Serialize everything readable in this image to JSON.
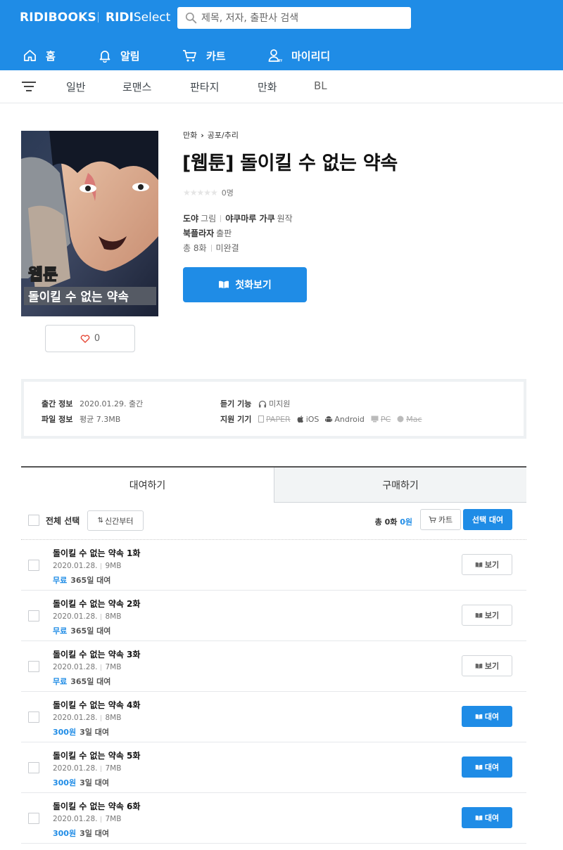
{
  "header": {
    "logo": "RIDIBOOKS",
    "select_brand": "RIDI",
    "select_suffix": "Select",
    "search_placeholder": "제목, 저자, 출판사 검색",
    "bg_color": "#1f8ce6",
    "nav": [
      {
        "label": "홈",
        "icon": "home-icon"
      },
      {
        "label": "알림",
        "icon": "bell-icon"
      },
      {
        "label": "카트",
        "icon": "cart-icon"
      },
      {
        "label": "마이리디",
        "icon": "my-icon"
      }
    ]
  },
  "categories": [
    "일반",
    "로맨스",
    "판타지",
    "만화",
    "BL"
  ],
  "book": {
    "breadcrumb": [
      "만화",
      "공포/추리"
    ],
    "title": "[웹툰] 돌이킬 수 없는 약속",
    "rating_count": "0명",
    "rating_stars": 0,
    "author": "도야",
    "author_role": "그림",
    "original_author": "야쿠마루 가쿠",
    "original_role": "원작",
    "publisher": "북플라자",
    "publisher_role": "출판",
    "episodes": "총 8화",
    "status": "미완결",
    "first_button": "첫화보기",
    "like_count": "0",
    "cover_text_top": "웹툰",
    "cover_text_bottom": "돌이킬 수 없는 약속"
  },
  "info": {
    "pub_label": "출간 정보",
    "pub_value": "2020.01.29. 출간",
    "file_label": "파일 정보",
    "file_value": "평균 7.3MB",
    "listen_label": "듣기 기능",
    "listen_value": "미지원",
    "device_label": "지원 기기",
    "devices": [
      {
        "name": "PAPER",
        "supported": false
      },
      {
        "name": "iOS",
        "supported": true
      },
      {
        "name": "Android",
        "supported": true
      },
      {
        "name": "PC",
        "supported": false
      },
      {
        "name": "Mac",
        "supported": false
      }
    ]
  },
  "tabs": {
    "rent": "대여하기",
    "buy": "구매하기"
  },
  "toolbar": {
    "select_all": "전체 선택",
    "sort": "신간부터",
    "total_prefix": "총 0화",
    "total_price": "0원",
    "cart": "카트",
    "rent_selected": "선택 대여"
  },
  "episodes": [
    {
      "title": "돌이킬 수 없는 약속 1화",
      "date": "2020.01.28.",
      "size": "9MB",
      "price": "무료",
      "period": "365일 대여",
      "button": "보기",
      "type": "view"
    },
    {
      "title": "돌이킬 수 없는 약속 2화",
      "date": "2020.01.28.",
      "size": "8MB",
      "price": "무료",
      "period": "365일 대여",
      "button": "보기",
      "type": "view"
    },
    {
      "title": "돌이킬 수 없는 약속 3화",
      "date": "2020.01.28.",
      "size": "7MB",
      "price": "무료",
      "period": "365일 대여",
      "button": "보기",
      "type": "view"
    },
    {
      "title": "돌이킬 수 없는 약속 4화",
      "date": "2020.01.28.",
      "size": "8MB",
      "price": "300원",
      "period": "3일 대여",
      "button": "대여",
      "type": "rent"
    },
    {
      "title": "돌이킬 수 없는 약속 5화",
      "date": "2020.01.28.",
      "size": "7MB",
      "price": "300원",
      "period": "3일 대여",
      "button": "대여",
      "type": "rent"
    },
    {
      "title": "돌이킬 수 없는 약속 6화",
      "date": "2020.01.28.",
      "size": "7MB",
      "price": "300원",
      "period": "3일 대여",
      "button": "대여",
      "type": "rent"
    }
  ]
}
